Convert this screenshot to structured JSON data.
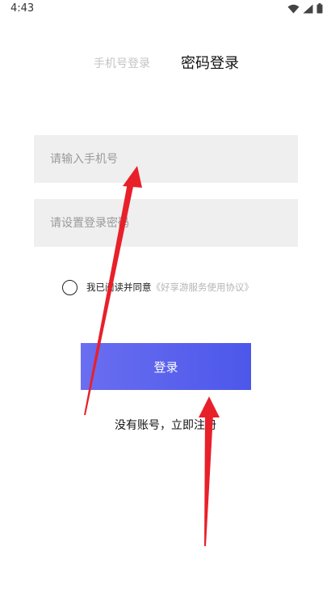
{
  "status_bar": {
    "time": "4:43",
    "icons": [
      "wifi-icon",
      "signal-icon",
      "battery-icon"
    ]
  },
  "tabs": [
    {
      "label": "手机号登录",
      "active": false
    },
    {
      "label": "密码登录",
      "active": true
    }
  ],
  "form": {
    "phone_placeholder": "请输入手机号",
    "password_placeholder": "请设置登录密码"
  },
  "agreement": {
    "text": "我已阅读并同意",
    "link": "《好享游服务使用协议》",
    "checked": false
  },
  "login_button": "登录",
  "register_link": "没有账号，立即注册",
  "colors": {
    "accent": "#5a62ee",
    "field_bg": "#efefef",
    "annotation_arrow": "#e8202a",
    "inactive_tab": "#c4c4c4"
  }
}
